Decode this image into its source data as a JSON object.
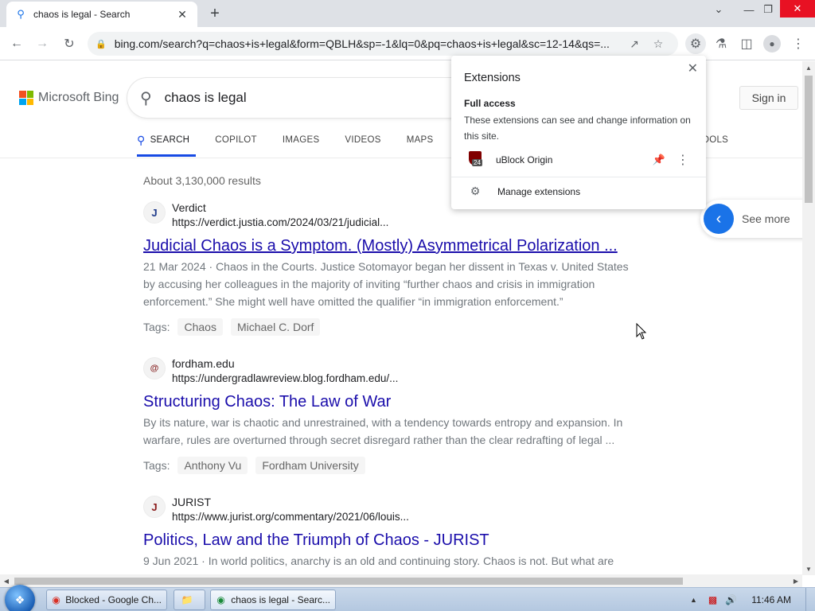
{
  "browser": {
    "tab_title": "chaos is legal - Search",
    "url": "bing.com/search?q=chaos+is+legal&form=QBLH&sp=-1&lq=0&pq=chaos+is+legal&sc=12-14&qs=...",
    "new_tab_symbol": "+",
    "tab_close_symbol": "✕"
  },
  "bing": {
    "logo_text": "Microsoft Bing",
    "query": "chaos is legal",
    "sign_in": "Sign in",
    "tabs": [
      "SEARCH",
      "COPILOT",
      "IMAGES",
      "VIDEOS",
      "MAPS"
    ],
    "tools_label": "OOLS",
    "results_count": "About 3,130,000 results",
    "see_more": "See more"
  },
  "results": [
    {
      "source": "Verdict",
      "favicon": "J",
      "url": "https://verdict.justia.com/2024/03/21/judicial...",
      "title": "Judicial Chaos is a Symptom. (Mostly) Asymmetrical Polarization ...",
      "date": "21 Mar 2024 ·",
      "snippet": "Chaos in the Courts. Justice Sotomayor began her dissent in Texas v. United States by accusing her colleagues in the majority of inviting “further chaos and crisis in immigration enforcement.” She might well have omitted the qualifier “in immigration enforcement.”",
      "tags_label": "Tags:",
      "tags": [
        "Chaos",
        "Michael C. Dorf"
      ]
    },
    {
      "source": "fordham.edu",
      "favicon": "@",
      "url": "https://undergradlawreview.blog.fordham.edu/...",
      "title": "Structuring Chaos: The Law of War",
      "snippet": "By its nature, war is chaotic and unrestrained, with a tendency towards entropy and expansion. In warfare, rules are overturned through secret disregard rather than the clear redrafting of legal ...",
      "tags_label": "Tags:",
      "tags": [
        "Anthony Vu",
        "Fordham University"
      ]
    },
    {
      "source": "JURIST",
      "favicon": "J",
      "url": "https://www.jurist.org/commentary/2021/06/louis...",
      "title": "Politics, Law and the Triumph of Chaos - JURIST",
      "date": "9 Jun 2021 ·",
      "snippet": "In world politics, anarchy is an old and continuing story. Chaos is not. But what are"
    }
  ],
  "extensions_popup": {
    "title": "Extensions",
    "full_access": "Full access",
    "description": "These extensions can see and change information on this site.",
    "extension_name": "uBlock Origin",
    "badge": "24",
    "manage": "Manage extensions"
  },
  "taskbar": {
    "items": [
      "Blocked - Google Ch...",
      "chaos is legal - Searc..."
    ],
    "clock": "11:46 AM"
  },
  "colors": {
    "link": "#1a0dab",
    "accent": "#174ae4",
    "close_red": "#e81123"
  }
}
